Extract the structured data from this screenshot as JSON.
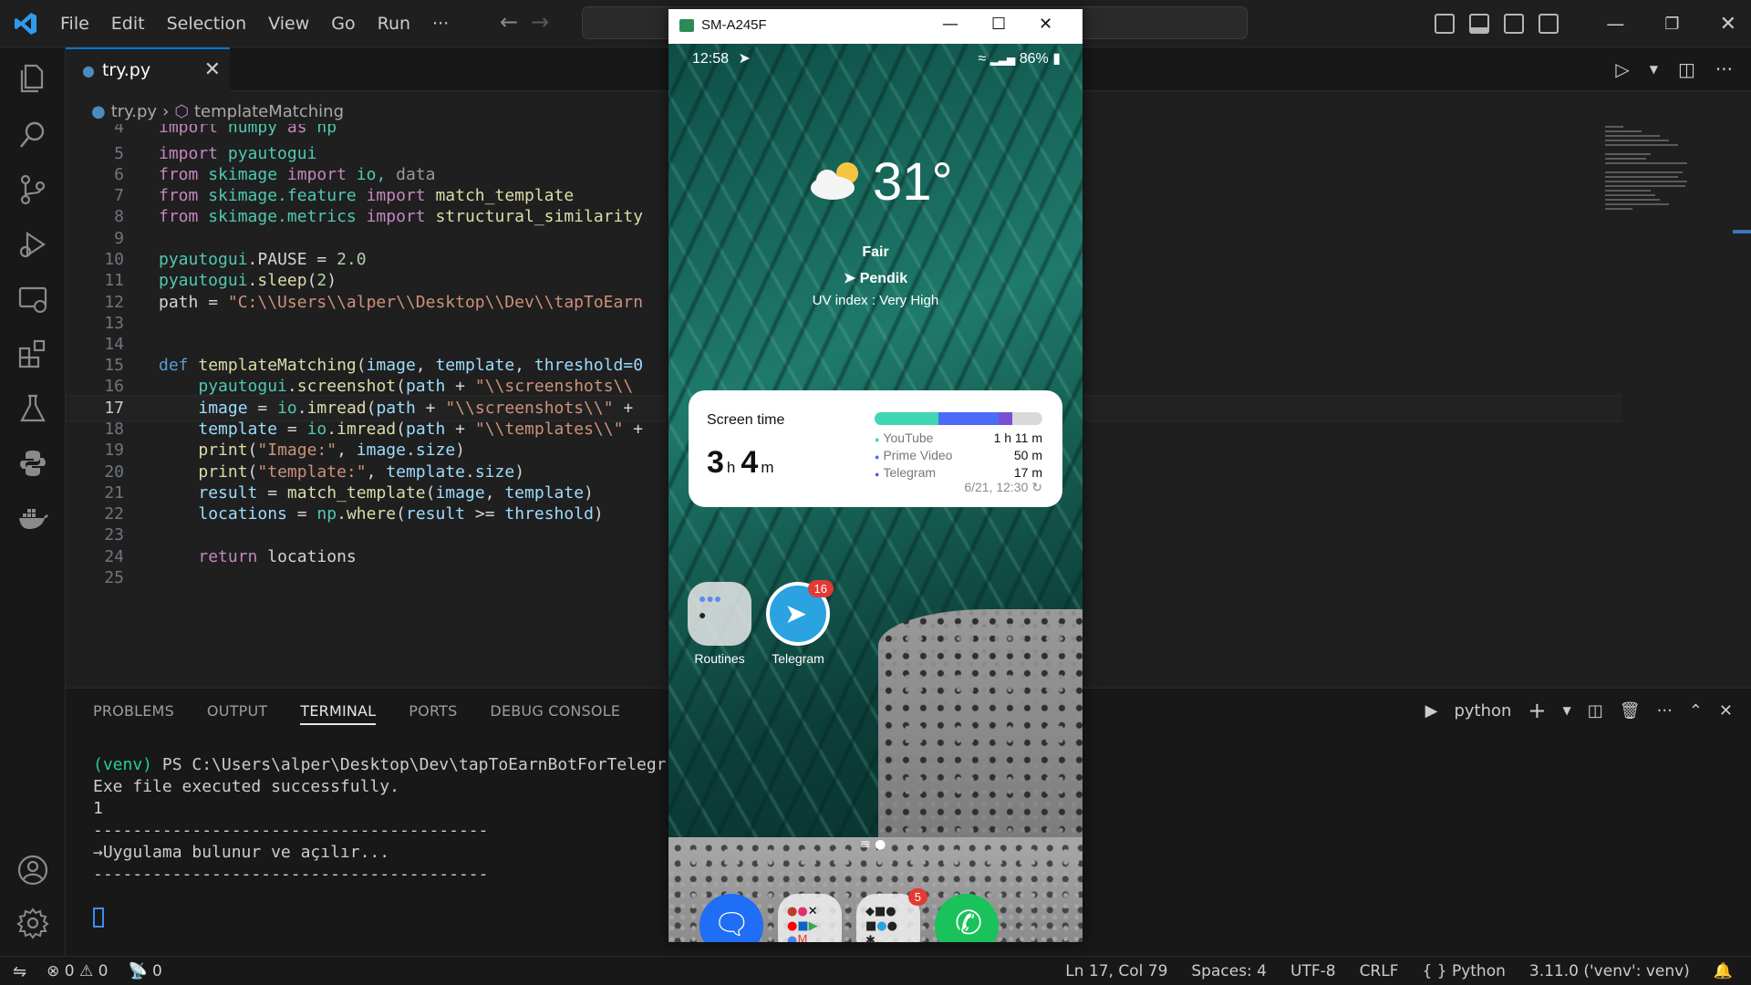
{
  "menu": [
    "File",
    "Edit",
    "Selection",
    "View",
    "Go",
    "Run",
    "···"
  ],
  "tab": {
    "filename": "try.py"
  },
  "breadcrumb": {
    "file": "try.py",
    "symbol": "templateMatching"
  },
  "code": {
    "lines": [
      {
        "n": "4"
      },
      {
        "n": "5"
      },
      {
        "n": "6"
      },
      {
        "n": "7"
      },
      {
        "n": "8"
      },
      {
        "n": "9"
      },
      {
        "n": "10"
      },
      {
        "n": "11"
      },
      {
        "n": "12"
      },
      {
        "n": "13"
      },
      {
        "n": "14"
      },
      {
        "n": "15"
      },
      {
        "n": "16"
      },
      {
        "n": "17"
      },
      {
        "n": "18"
      },
      {
        "n": "19"
      },
      {
        "n": "20"
      },
      {
        "n": "21"
      },
      {
        "n": "22"
      },
      {
        "n": "23"
      },
      {
        "n": "24"
      },
      {
        "n": "25"
      }
    ],
    "t": {
      "l4a": "import",
      "l4b": " numpy ",
      "l4c": "as",
      "l4d": " np",
      "l5a": "import",
      "l5b": " pyautogui",
      "l6a": "from",
      "l6b": " skimage ",
      "l6c": "import",
      "l6d": " io, ",
      "l6e": "data",
      "l7a": "from",
      "l7b": " skimage.feature ",
      "l7c": "import",
      "l7d": " match_template",
      "l8a": "from",
      "l8b": " skimage.metrics ",
      "l8c": "import",
      "l8d": " structural_similarity",
      "l10a": "pyautogui",
      "l10b": ".",
      "l10c": "PAUSE",
      "l10d": " = ",
      "l10e": "2.0",
      "l11a": "pyautogui",
      "l11b": ".",
      "l11c": "sleep",
      "l11d": "(",
      "l11e": "2",
      "l11f": ")",
      "l12a": "path",
      "l12b": " = ",
      "l12c": "\"C:\\\\Users\\\\alper\\\\Desktop\\\\Dev\\\\tapToEarn",
      "l15a": "def",
      "l15b": " templateMatching",
      "l15c": "(",
      "l15d": "image",
      "l15e": ", ",
      "l15f": "template",
      "l15g": ", ",
      "l15h": "threshold=0",
      "l16a": "pyautogui",
      "l16b": ".",
      "l16c": "screenshot",
      "l16d": "(",
      "l16e": "path",
      "l16f": " + ",
      "l16g": "\"\\\\screenshots\\\\",
      "l17a": "image",
      "l17b": " = ",
      "l17c": "io",
      "l17d": ".",
      "l17e": "imread",
      "l17f": "(",
      "l17g": "path",
      "l17h": " + ",
      "l17i": "\"\\\\screenshots\\\\\"",
      "l17j": " +",
      "l18a": "template",
      "l18b": " = ",
      "l18c": "io",
      "l18d": ".",
      "l18e": "imread",
      "l18f": "(",
      "l18g": "path",
      "l18h": " + ",
      "l18i": "\"\\\\templates\\\\\"",
      "l18j": " +",
      "l19a": "print",
      "l19b": "(",
      "l19c": "\"Image:\"",
      "l19d": ", ",
      "l19e": "image",
      "l19f": ".",
      "l19g": "size",
      "l19h": ")",
      "l20a": "print",
      "l20b": "(",
      "l20c": "\"template:\"",
      "l20d": ", ",
      "l20e": "template",
      "l20f": ".",
      "l20g": "size",
      "l20h": ")",
      "l21a": "result",
      "l21b": " = ",
      "l21c": "match_template",
      "l21d": "(",
      "l21e": "image",
      "l21f": ", ",
      "l21g": "template",
      "l21h": ")",
      "l22a": "locations",
      "l22b": " = ",
      "l22c": "np",
      "l22d": ".",
      "l22e": "where",
      "l22f": "(",
      "l22g": "result",
      "l22h": " >= ",
      "l22i": "threshold",
      "l22j": ")",
      "l24a": "return",
      "l24b": " locations"
    }
  },
  "panel": {
    "tabs": [
      "PROBLEMS",
      "OUTPUT",
      "TERMINAL",
      "PORTS",
      "DEBUG CONSOLE"
    ],
    "active_tab": "TERMINAL",
    "shell": "python"
  },
  "terminal": {
    "venv": "(venv)",
    "prompt": " PS C:\\Users\\alper\\Desktop\\Dev\\tapToEarnBotForTelegr",
    "l2": "Exe file executed successfully.",
    "l3": "1",
    "l4": "----------------------------------------",
    "l5": "→Uygulama bulunur ve açılır...",
    "l6": "----------------------------------------"
  },
  "statusbar": {
    "errors": "0",
    "warnings": "0",
    "ports": "0",
    "position": "Ln 17, Col 79",
    "spaces": "Spaces: 4",
    "encoding": "UTF-8",
    "eol": "CRLF",
    "language": "Python",
    "interpreter": "3.11.0 ('venv': venv)"
  },
  "phone": {
    "window_title": "SM-A245F",
    "time": "12:58",
    "battery": "86%",
    "weather": {
      "temp": "31°",
      "condition": "Fair",
      "location": "Pendik",
      "uv": "UV index : Very High"
    },
    "screen_time": {
      "title": "Screen time",
      "hours": "3",
      "h_unit": "h",
      "minutes": "4",
      "m_unit": "m",
      "apps": [
        {
          "name": "YouTube",
          "time": "1 h 11 m",
          "color": "#3fd6b4",
          "share": 0.38
        },
        {
          "name": "Prime Video",
          "time": "50 m",
          "color": "#4a6cf7",
          "share": 0.36
        },
        {
          "name": "Telegram",
          "time": "17 m",
          "color": "#7a4fd6",
          "share": 0.08
        }
      ],
      "updated": "6/21, 12:30"
    },
    "apps": [
      {
        "label": "Routines"
      },
      {
        "label": "Telegram",
        "badge": "16"
      }
    ],
    "dock_badge": "5"
  }
}
